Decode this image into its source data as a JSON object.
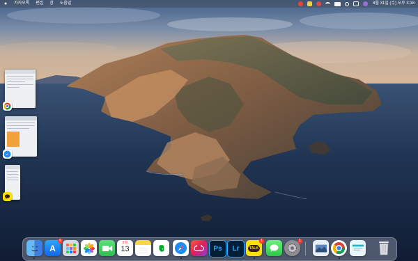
{
  "menubar": {
    "apple": "",
    "items": [
      "카카오톡",
      "편집",
      "창",
      "도움말"
    ],
    "clock": "8월 31일 (수) 오후 3:18"
  },
  "stage": {
    "apps": [
      "chrome",
      "safari",
      "kakaotalk"
    ]
  },
  "dock": {
    "apps": [
      {
        "name": "finder",
        "running": true
      },
      {
        "name": "app-store",
        "badge": "6"
      },
      {
        "name": "launchpad"
      },
      {
        "name": "photos"
      },
      {
        "name": "facetime"
      },
      {
        "name": "calendar",
        "month": "8월",
        "day": "13"
      },
      {
        "name": "notes"
      },
      {
        "name": "evernote"
      },
      {
        "name": "safari",
        "running": true
      },
      {
        "name": "creative-cloud"
      },
      {
        "name": "photoshop",
        "label": "Ps"
      },
      {
        "name": "lightroom",
        "label": "Lr"
      },
      {
        "name": "kakaotalk",
        "label": "TALK",
        "badge": "1",
        "running": true
      },
      {
        "name": "messages"
      },
      {
        "name": "system-preferences",
        "badge": "1"
      },
      {
        "name": "preview"
      },
      {
        "name": "chrome",
        "running": true
      },
      {
        "name": "downloads-stack"
      },
      {
        "name": "trash"
      }
    ],
    "calendar": {
      "month": "8월",
      "day": "13"
    },
    "badges": {
      "app_store": "6",
      "kakaotalk": "1",
      "system_preferences": "1"
    },
    "labels": {
      "ps": "Ps",
      "lr": "Lr",
      "talk": "TALK"
    }
  },
  "colors": {
    "sky": "#5a7ea8",
    "sea": "#1d3454",
    "island": "#8a6b4f",
    "accent": "#0a84ff"
  }
}
